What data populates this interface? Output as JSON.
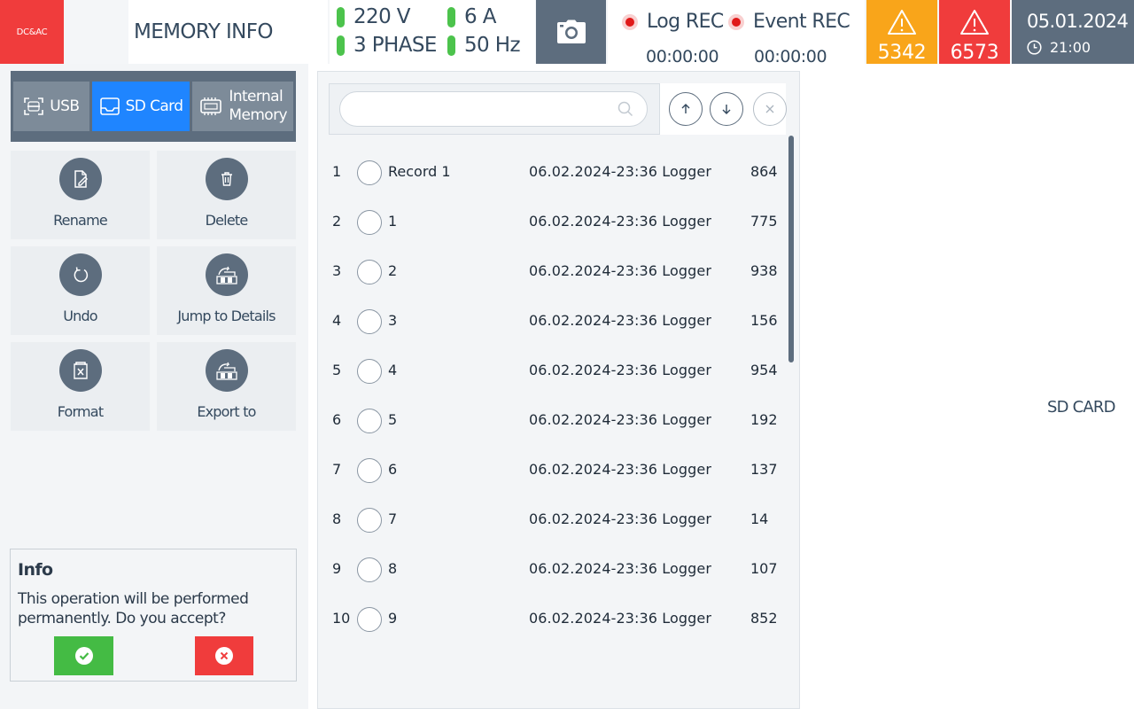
{
  "header": {
    "logo": "DC&AC",
    "title": "MEMORY INFO",
    "electrical": {
      "voltage": "220 V",
      "current": "6 A",
      "phase": "3 PHASE",
      "frequency": "50 Hz"
    },
    "log_rec": {
      "label": "Log REC",
      "time": "00:00:00"
    },
    "event_rec": {
      "label": "Event REC",
      "time": "00:00:00"
    },
    "warning_count": "5342",
    "alarm_count": "6573",
    "date": "05.01.2024",
    "time": "21:00",
    "colors": {
      "warning": "#f9a51a",
      "alarm": "#f03c3c",
      "ok": "#4cc34c",
      "accent": "#1f85ff",
      "slate": "#5d6d7e"
    }
  },
  "sources": [
    {
      "label": "USB",
      "icon": "usb-scan-icon"
    },
    {
      "label": "SD Card",
      "icon": "sd-card-icon"
    },
    {
      "label_line1": "Internal",
      "label_line2": "Memory",
      "icon": "chip-icon"
    }
  ],
  "actions": {
    "rename": "Rename",
    "delete": "Delete",
    "undo": "Undo",
    "jump": "Jump to Details",
    "format": "Format",
    "export": "Export to"
  },
  "info": {
    "title": "Info",
    "text": "This operation will be performed permanently. Do you accept?"
  },
  "search": {
    "placeholder": ""
  },
  "records": [
    {
      "index": "1",
      "name": "Record 1",
      "date": "06.02.2024-23:36",
      "type": "Logger",
      "size": "864"
    },
    {
      "index": "2",
      "name": "1",
      "date": "06.02.2024-23:36",
      "type": "Logger",
      "size": "775"
    },
    {
      "index": "3",
      "name": "2",
      "date": "06.02.2024-23:36",
      "type": "Logger",
      "size": "938"
    },
    {
      "index": "4",
      "name": "3",
      "date": "06.02.2024-23:36",
      "type": "Logger",
      "size": "156"
    },
    {
      "index": "5",
      "name": "4",
      "date": "06.02.2024-23:36",
      "type": "Logger",
      "size": "954"
    },
    {
      "index": "6",
      "name": "5",
      "date": "06.02.2024-23:36",
      "type": "Logger",
      "size": "192"
    },
    {
      "index": "7",
      "name": "6",
      "date": "06.02.2024-23:36",
      "type": "Logger",
      "size": "137"
    },
    {
      "index": "8",
      "name": "7",
      "date": "06.02.2024-23:36",
      "type": "Logger",
      "size": "14"
    },
    {
      "index": "9",
      "name": "8",
      "date": "06.02.2024-23:36",
      "type": "Logger",
      "size": "107"
    },
    {
      "index": "10",
      "name": "9",
      "date": "06.02.2024-23:36",
      "type": "Logger",
      "size": "852"
    }
  ],
  "right_label": "SD CARD"
}
